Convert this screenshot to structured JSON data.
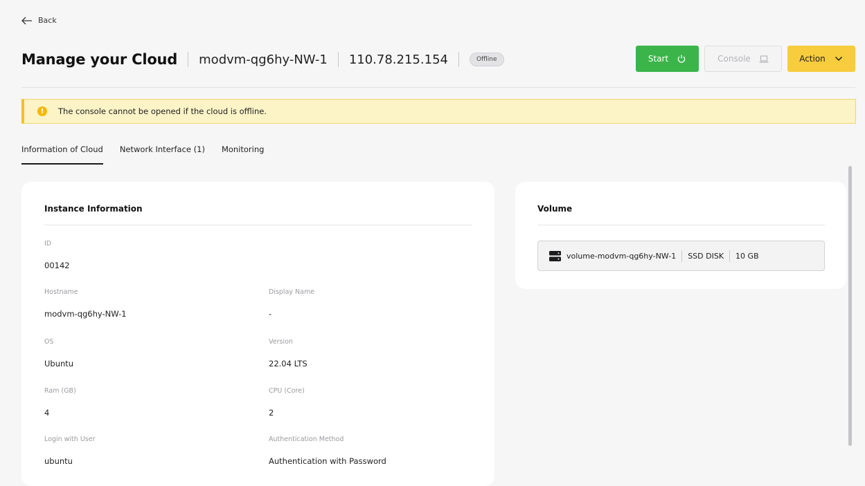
{
  "nav": {
    "back_label": "Back"
  },
  "header": {
    "title": "Manage your Cloud",
    "vm_name": "modvm-qg6hy-NW-1",
    "ip": "110.78.215.154",
    "status": "Offline"
  },
  "toolbar": {
    "start_label": "Start",
    "console_label": "Console",
    "action_label": "Action"
  },
  "alert": {
    "message": "The console cannot be opened if the cloud is offline."
  },
  "tabs": [
    {
      "label": "Information of Cloud"
    },
    {
      "label": "Network Interface (1)"
    },
    {
      "label": "Monitoring"
    }
  ],
  "instance": {
    "title": "Instance Information",
    "id": {
      "label": "ID",
      "value": "00142"
    },
    "hostname": {
      "label": "Hostname",
      "value": "modvm-qg6hy-NW-1"
    },
    "display_name": {
      "label": "Display Name",
      "value": "-"
    },
    "os": {
      "label": "OS",
      "value": "Ubuntu"
    },
    "version": {
      "label": "Version",
      "value": "22.04 LTS"
    },
    "ram": {
      "label": "Ram (GB)",
      "value": "4"
    },
    "cpu": {
      "label": "CPU (Core)",
      "value": "2"
    },
    "login_user": {
      "label": "Login with User",
      "value": "ubuntu"
    },
    "auth_method": {
      "label": "Authentication Method",
      "value": "Authentication with Password"
    }
  },
  "volume": {
    "title": "Volume",
    "name": "volume-modvm-qg6hy-NW-1",
    "type": "SSD DISK",
    "size": "10 GB"
  },
  "colors": {
    "start": "#3bb54a",
    "action": "#f7cc3d",
    "alert_bg": "#fcf3c6",
    "alert_accent": "#f2c02e"
  },
  "icons": {
    "back": "arrow-left-icon",
    "power": "power-icon",
    "console": "laptop-icon",
    "action": "chevron-down-icon",
    "warning": "warning-icon",
    "disk": "disk-icon"
  }
}
